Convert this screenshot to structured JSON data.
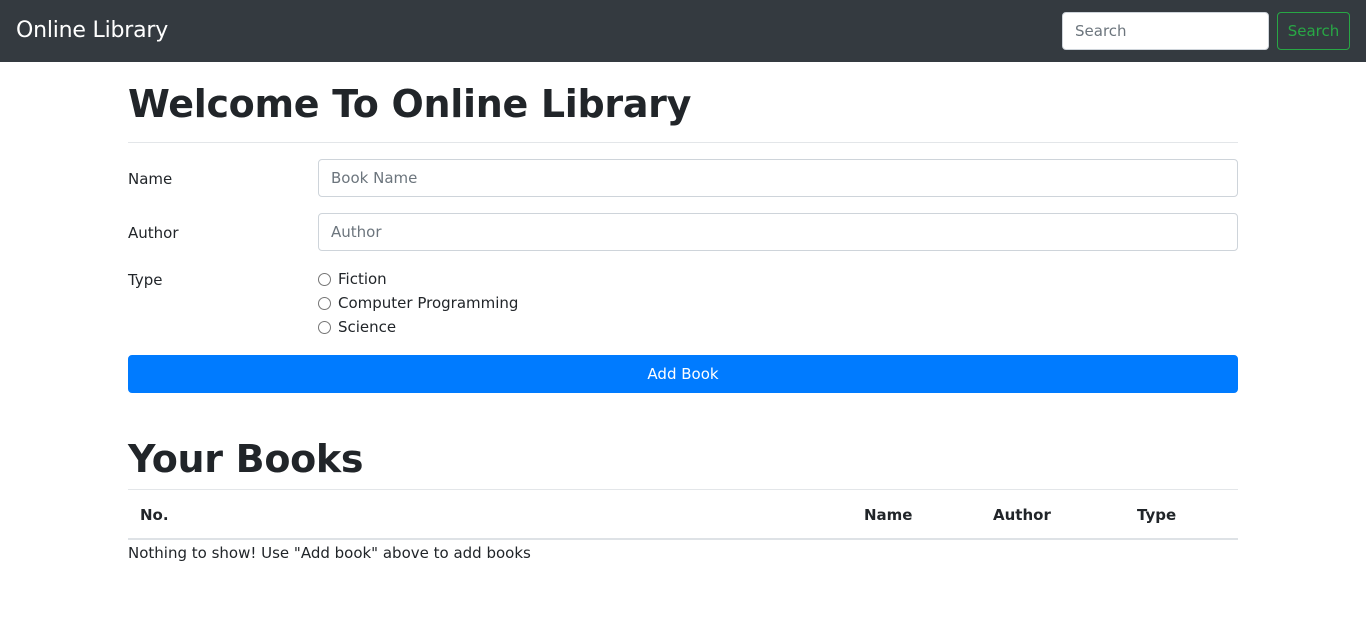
{
  "navbar": {
    "brand": "Online Library",
    "search_placeholder": "Search",
    "search_button": "Search"
  },
  "form": {
    "title": "Welcome To Online Library",
    "name_label": "Name",
    "name_placeholder": "Book Name",
    "author_label": "Author",
    "author_placeholder": "Author",
    "type_label": "Type",
    "type_options": [
      "Fiction",
      "Computer Programming",
      "Science"
    ],
    "submit_label": "Add Book"
  },
  "books": {
    "title": "Your Books",
    "columns": [
      "No.",
      "Name",
      "Author",
      "Type"
    ],
    "empty_message": "Nothing to show! Use \"Add book\" above to add books"
  },
  "colors": {
    "navbar_bg": "#343a40",
    "primary": "#007bff",
    "success": "#28a745"
  }
}
